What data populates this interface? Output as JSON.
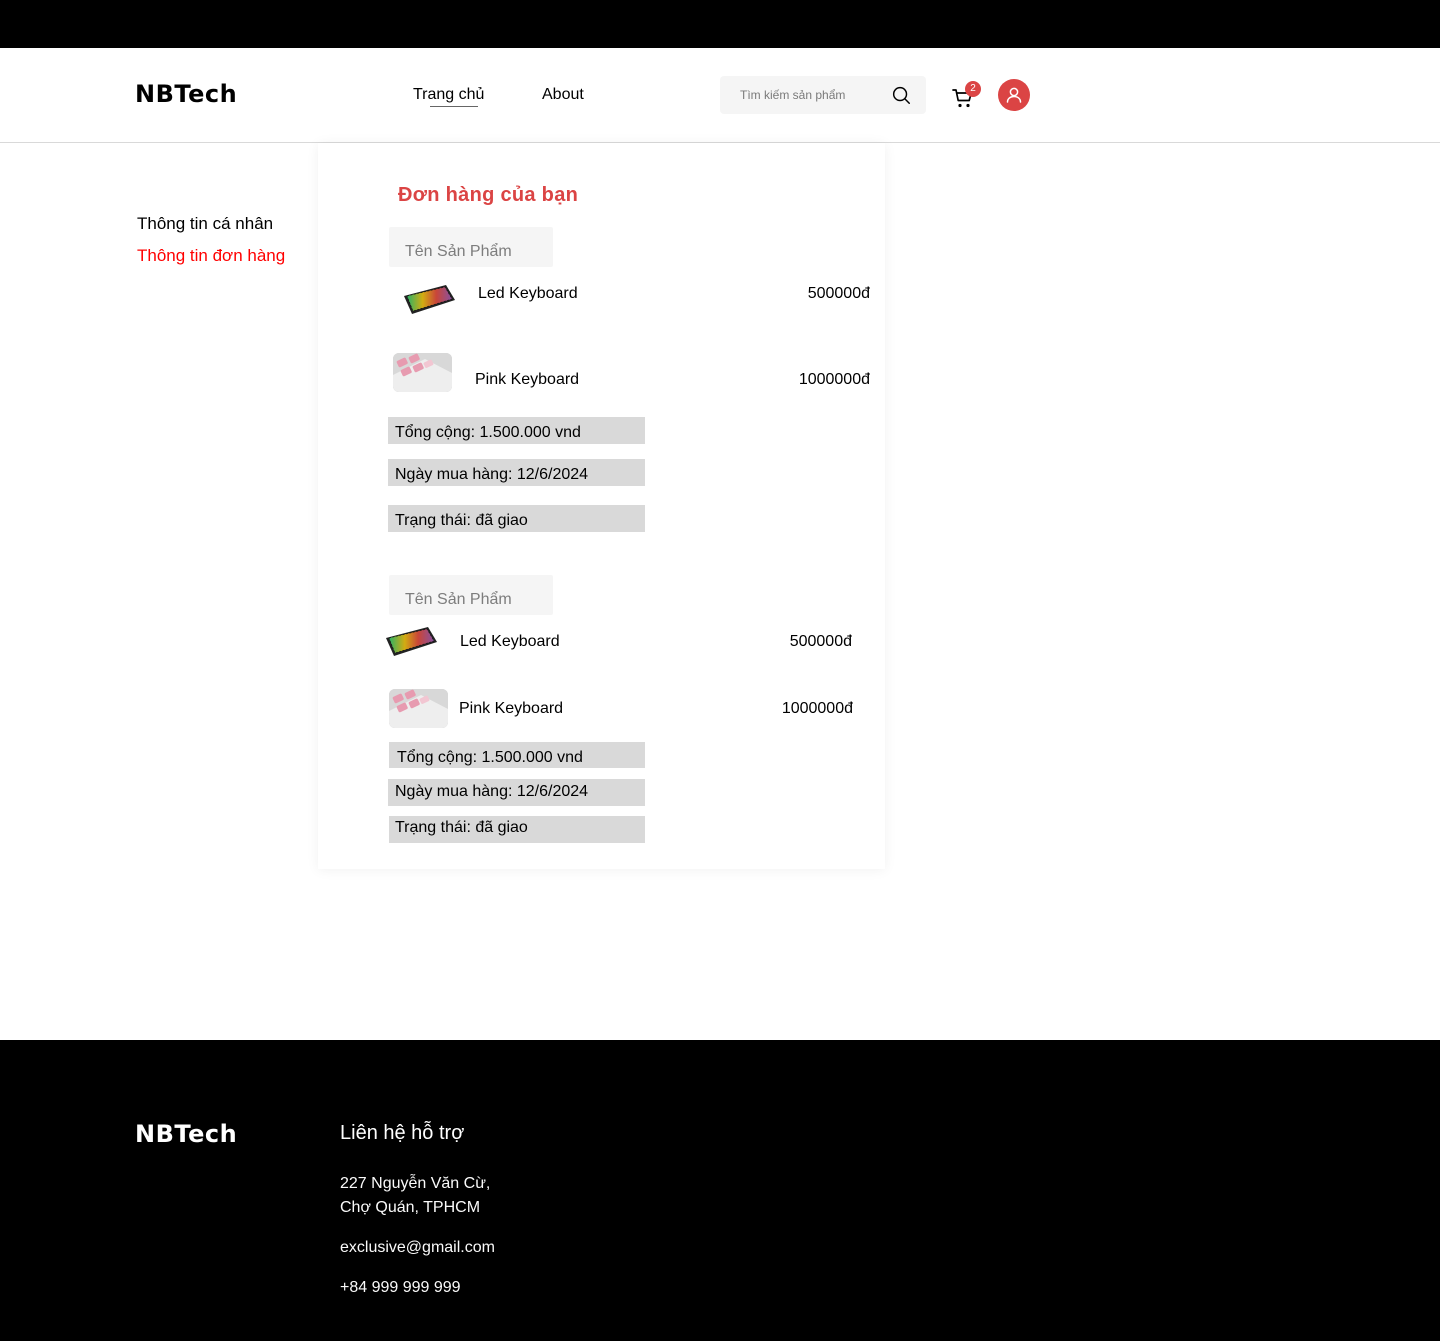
{
  "header": {
    "logo": "NBTech",
    "nav": {
      "home": "Trang chủ",
      "about": "About"
    },
    "search": {
      "placeholder": "Tìm kiếm sản phẩm"
    },
    "cart_count": "2"
  },
  "sidebar": {
    "personal_info": "Thông tin cá nhân",
    "order_info": "Thông tin đơn hàng"
  },
  "orders": {
    "title": "Đơn hàng của bạn",
    "list": [
      {
        "column_header": "Tên Sản Phẩm",
        "items": [
          {
            "name": "Led Keyboard",
            "price": "500000đ",
            "thumb": "led-keyboard"
          },
          {
            "name": "Pink Keyboard",
            "price": "1000000đ",
            "thumb": "pink-keyboard"
          }
        ],
        "total": "Tổng cộng: 1.500.000 vnd",
        "date": "Ngày mua hàng: 12/6/2024",
        "status": "Trạng thái: đã giao"
      },
      {
        "column_header": "Tên Sản Phẩm",
        "items": [
          {
            "name": "Led Keyboard",
            "price": "500000đ",
            "thumb": "led-keyboard"
          },
          {
            "name": "Pink Keyboard",
            "price": "1000000đ",
            "thumb": "pink-keyboard"
          }
        ],
        "total": "Tổng cộng: 1.500.000 vnd",
        "date": "Ngày mua hàng: 12/6/2024",
        "status": "Trạng thái: đã giao"
      }
    ]
  },
  "footer": {
    "logo": "NBTech",
    "heading": "Liên hệ hỗ trợ",
    "address_line1": "227 Nguyễn Văn Cừ,",
    "address_line2": "Chợ Quán, TPHCM",
    "email": "exclusive@gmail.com",
    "phone": "+84 999 999 999"
  },
  "colors": {
    "accent": "#db4444",
    "active_link": "#ff0000",
    "info_box": "#d9d9d9"
  }
}
